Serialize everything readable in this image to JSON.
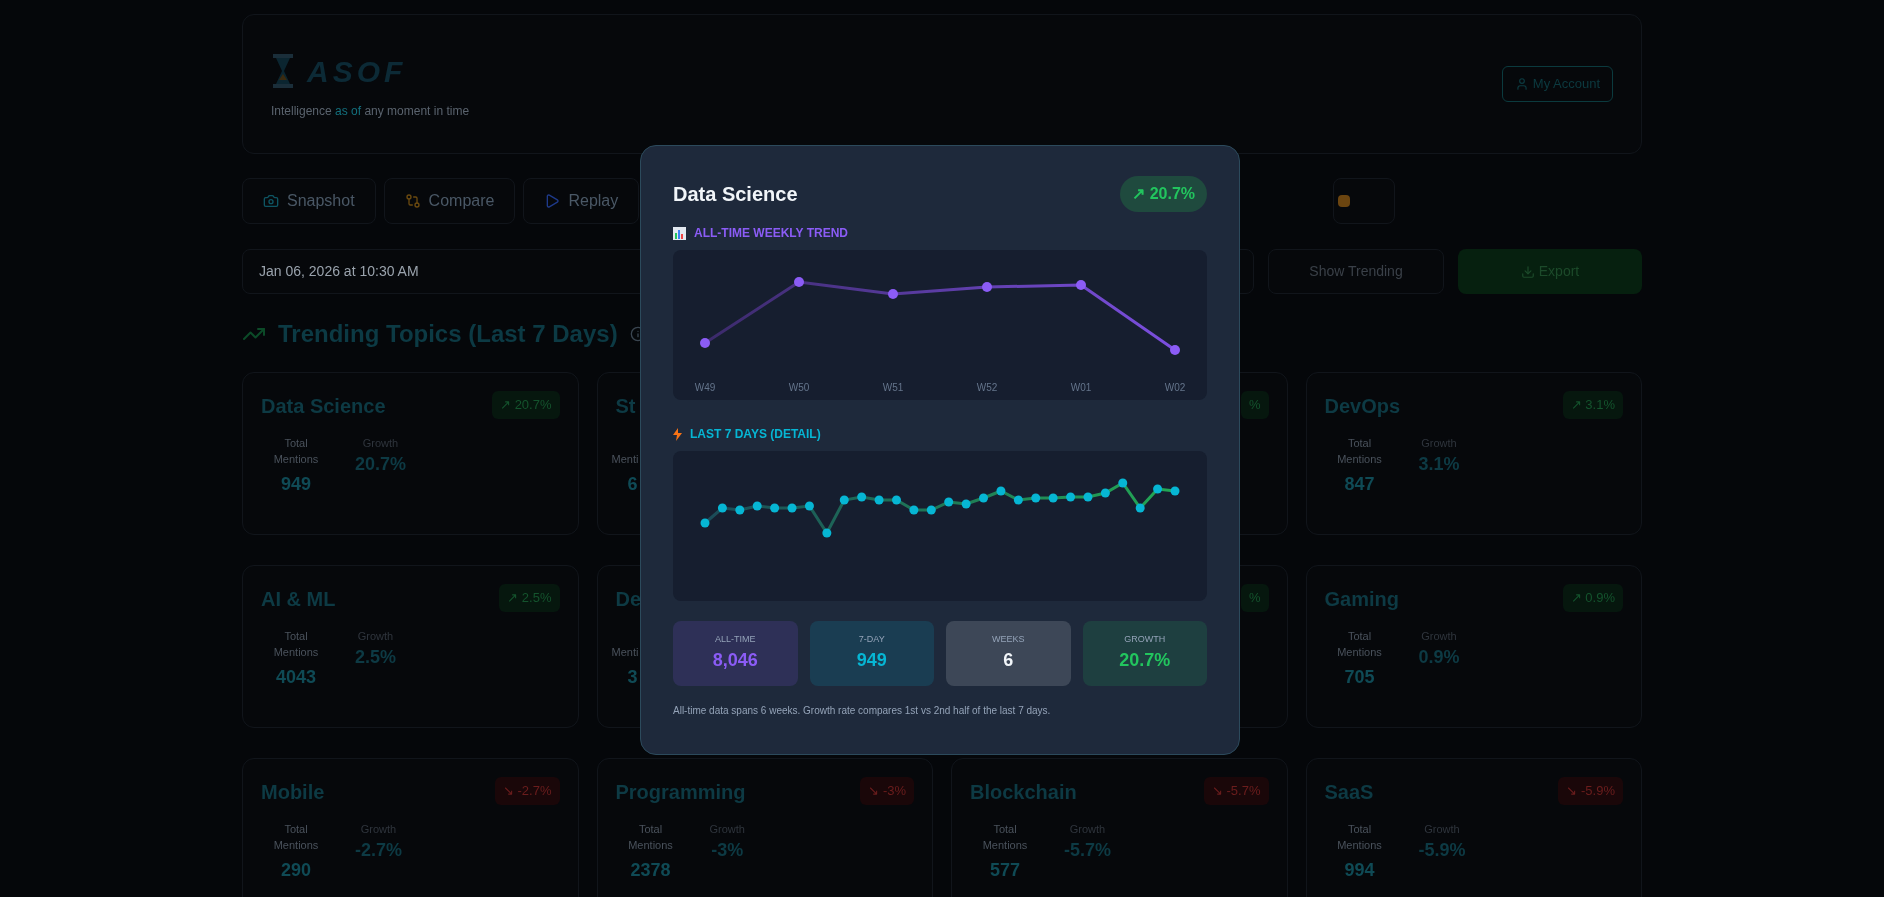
{
  "header": {
    "logo": "ASOF",
    "tagline": [
      {
        "text": "Intelligence ",
        "highlight": false
      },
      {
        "text": "as of",
        "highlight": true
      },
      {
        "text": " any moment in time",
        "highlight": false
      }
    ],
    "account_button": "My Account"
  },
  "toolbar": [
    {
      "label": "Snapshot",
      "kind": "snapshot"
    },
    {
      "label": "Compare",
      "kind": "compare"
    },
    {
      "label": "Replay",
      "kind": "replay"
    }
  ],
  "date_field": {
    "value": "Jan 06, 2026 at 10:30 AM"
  },
  "show_trending_button": "Show Trending",
  "export_button": "Export",
  "section_title": "Trending Topics (Last 7 Days)",
  "cards": [
    {
      "title": "Data Science",
      "badge": "↗ 20.7%",
      "rising": true,
      "mentions_label": "Total Mentions",
      "mentions": "949",
      "growth_label": "Growth",
      "growth": "20.7%"
    },
    {
      "title": "St",
      "mentions_label": "Menti",
      "mentions": "6"
    },
    {
      "badge": "%",
      "rising": true
    },
    {
      "title": "DevOps",
      "badge": "↗ 3.1%",
      "rising": true,
      "mentions_label": "Total Mentions",
      "mentions": "847",
      "growth_label": "Growth",
      "growth": "3.1%"
    },
    {
      "title": "AI & ML",
      "badge": "↗ 2.5%",
      "rising": true,
      "mentions_label": "Total Mentions",
      "mentions": "4043",
      "growth_label": "Growth",
      "growth": "2.5%"
    },
    {
      "title": "De",
      "mentions_label": "Menti",
      "mentions": "3"
    },
    {
      "badge": "%",
      "rising": true
    },
    {
      "title": "Gaming",
      "badge": "↗ 0.9%",
      "rising": true,
      "mentions_label": "Total Mentions",
      "mentions": "705",
      "growth_label": "Growth",
      "growth": "0.9%"
    },
    {
      "title": "Mobile",
      "badge": "↘ -2.7%",
      "rising": false,
      "mentions_label": "Total Mentions",
      "mentions": "290",
      "growth_label": "Growth",
      "growth": "-2.7%"
    },
    {
      "title": "Programming",
      "badge": "↘ -3%",
      "rising": false,
      "mentions_label": "Total Mentions",
      "mentions": "2378",
      "growth_label": "Growth",
      "growth": "-3%"
    },
    {
      "title": "Blockchain",
      "badge": "↘ -5.7%",
      "rising": false,
      "mentions_label": "Total Mentions",
      "mentions": "577",
      "growth_label": "Growth",
      "growth": "-5.7%"
    },
    {
      "title": "SaaS",
      "badge": "↘ -5.9%",
      "rising": false,
      "mentions_label": "Total Mentions",
      "mentions": "994",
      "growth_label": "Growth",
      "growth": "-5.9%"
    }
  ],
  "modal": {
    "title": "Data Science",
    "badge": "↗ 20.7%",
    "weekly_label": "ALL-TIME WEEKLY TREND",
    "weekly_x_labels": [
      "W49",
      "W50",
      "W51",
      "W52",
      "W01",
      "W02"
    ],
    "detail_label": "LAST 7 DAYS (DETAIL)",
    "stats": [
      {
        "label": "ALL-TIME",
        "value": "8,046",
        "color": "#8b5cf6"
      },
      {
        "label": "7-DAY",
        "value": "949",
        "color": "#06b6d4"
      },
      {
        "label": "WEEKS",
        "value": "6",
        "color": "#f1f5f9"
      },
      {
        "label": "GROWTH",
        "value": "20.7%",
        "color": "#22c55e"
      }
    ],
    "note": "All-time data spans 6 weeks. Growth rate compares 1st vs 2nd half of the last 7 days."
  }
}
